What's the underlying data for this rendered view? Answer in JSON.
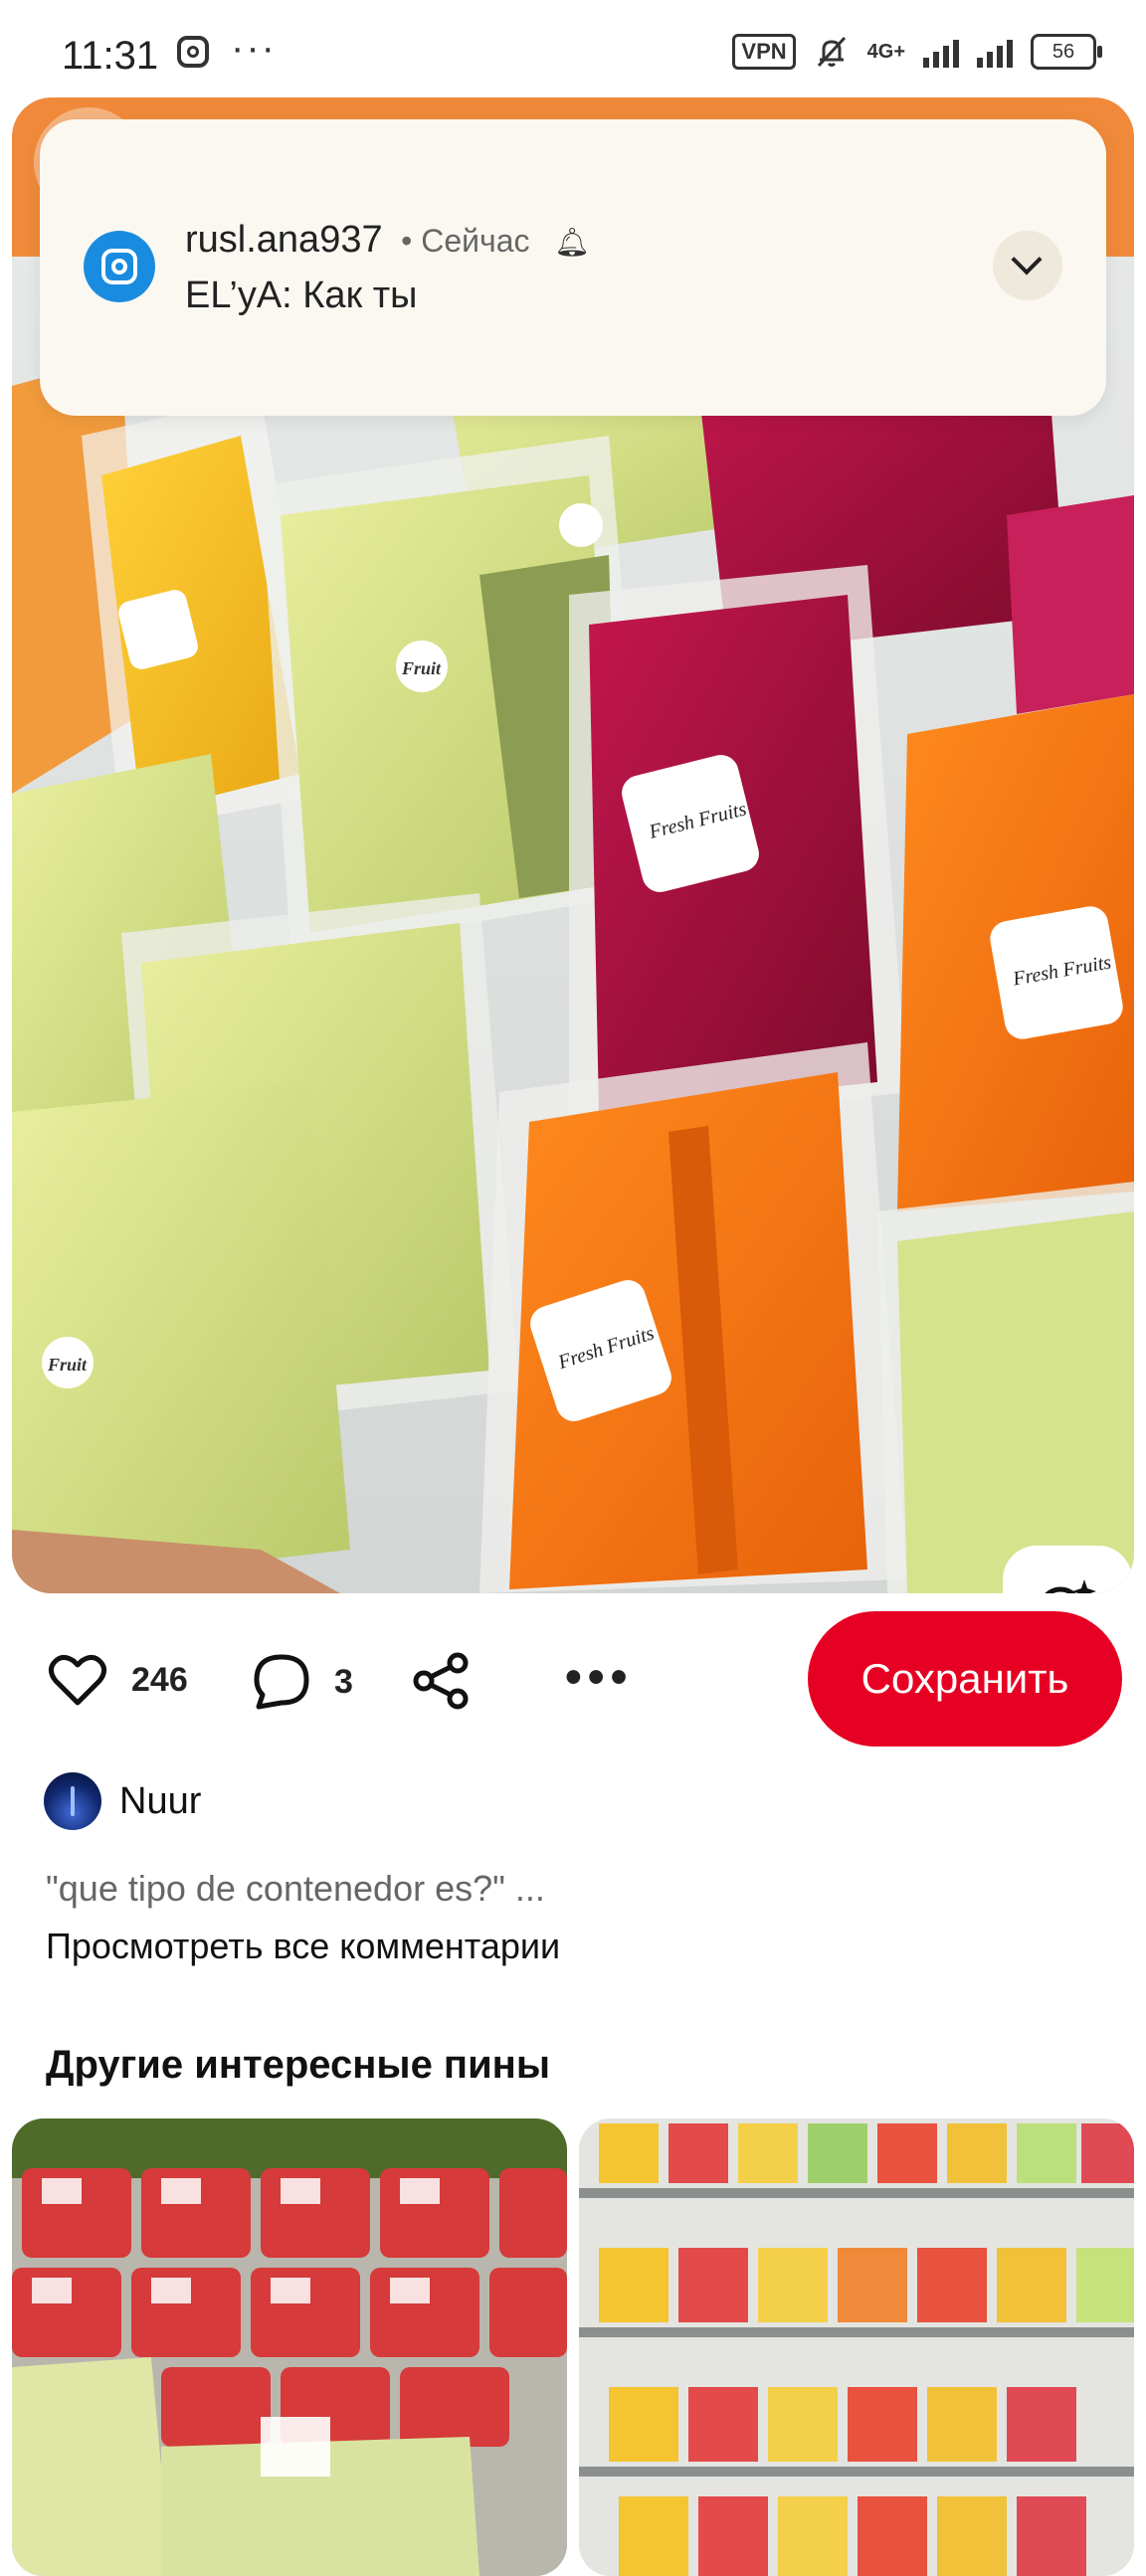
{
  "status_bar": {
    "time": "11:31",
    "vpn": "VPN",
    "network": "4G+",
    "battery": "56"
  },
  "notification": {
    "username": "rusl.ana937",
    "time": "• Сейчас",
    "sender": "EL’yA:",
    "message": "Как ты"
  },
  "pin": {
    "likes": "246",
    "comments": "3",
    "save_label": "Сохранить",
    "author": "Nuur",
    "comment_preview": "\"que tipo de contenedor es?\" ...",
    "view_all_comments": "Просмотреть все комментарии"
  },
  "more_pins": {
    "title": "Другие интересные пины"
  },
  "product_labels": {
    "brand": "Fruit",
    "line": "Fresh Fruits"
  },
  "colors": {
    "accent": "#e60023",
    "notification_bg": "#fbf8f2",
    "instagram": "#1a8ce0"
  }
}
